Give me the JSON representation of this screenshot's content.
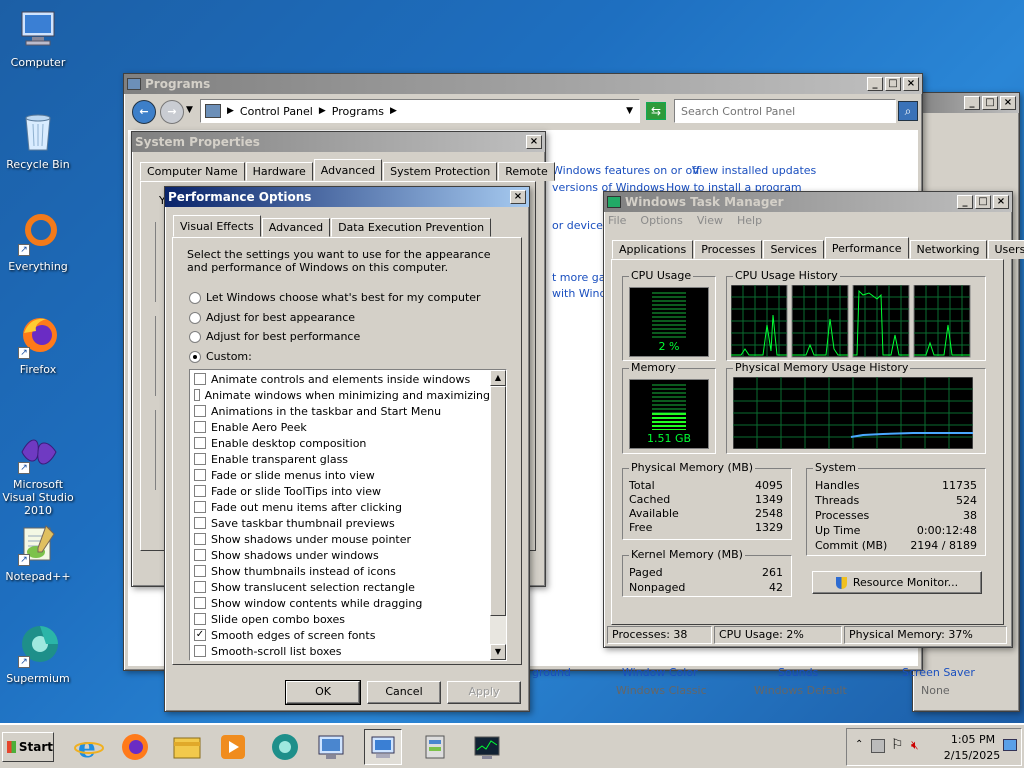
{
  "desktop": {
    "icons": [
      {
        "label": "Computer"
      },
      {
        "label": "Recycle Bin"
      },
      {
        "label": "Everything"
      },
      {
        "label": "Firefox"
      },
      {
        "label": "Microsoft Visual Studio 2010"
      },
      {
        "label": "Notepad++"
      },
      {
        "label": "Supermium"
      }
    ]
  },
  "programs_window": {
    "title": "Programs",
    "breadcrumb": [
      "Control Panel",
      "Programs"
    ],
    "search_placeholder": "Search Control Panel",
    "links": [
      "Windows features on or off",
      "View installed updates",
      "versions of Windows",
      "How to install a program",
      "or devices",
      "t more gad",
      "with Windo"
    ],
    "bottom_items": [
      {
        "title": "ground",
        "sub": ""
      },
      {
        "title": "Window Color",
        "sub": "Windows Classic"
      },
      {
        "title": "Sounds",
        "sub": "Windows Default"
      },
      {
        "title": "Screen Saver",
        "sub": "None"
      }
    ],
    "y_letter": "Y"
  },
  "system_properties": {
    "title": "System Properties",
    "tabs": [
      "Computer Name",
      "Hardware",
      "Advanced",
      "System Protection",
      "Remote"
    ],
    "selected_tab": "Advanced"
  },
  "performance_options": {
    "title": "Performance Options",
    "tabs": [
      "Visual Effects",
      "Advanced",
      "Data Execution Prevention"
    ],
    "description": "Select the settings you want to use for the appearance and performance of Windows on this computer.",
    "radios": [
      {
        "label": "Let Windows choose what's best for my computer",
        "checked": false
      },
      {
        "label": "Adjust for best appearance",
        "checked": false
      },
      {
        "label": "Adjust for best performance",
        "checked": false
      },
      {
        "label": "Custom:",
        "checked": true
      }
    ],
    "effects": [
      {
        "label": "Animate controls and elements inside windows",
        "checked": false
      },
      {
        "label": "Animate windows when minimizing and maximizing",
        "checked": false
      },
      {
        "label": "Animations in the taskbar and Start Menu",
        "checked": false
      },
      {
        "label": "Enable Aero Peek",
        "checked": false
      },
      {
        "label": "Enable desktop composition",
        "checked": false
      },
      {
        "label": "Enable transparent glass",
        "checked": false
      },
      {
        "label": "Fade or slide menus into view",
        "checked": false
      },
      {
        "label": "Fade or slide ToolTips into view",
        "checked": false
      },
      {
        "label": "Fade out menu items after clicking",
        "checked": false
      },
      {
        "label": "Save taskbar thumbnail previews",
        "checked": false
      },
      {
        "label": "Show shadows under mouse pointer",
        "checked": false
      },
      {
        "label": "Show shadows under windows",
        "checked": false
      },
      {
        "label": "Show thumbnails instead of icons",
        "checked": false
      },
      {
        "label": "Show translucent selection rectangle",
        "checked": false
      },
      {
        "label": "Show window contents while dragging",
        "checked": false
      },
      {
        "label": "Slide open combo boxes",
        "checked": false
      },
      {
        "label": "Smooth edges of screen fonts",
        "checked": true
      },
      {
        "label": "Smooth-scroll list boxes",
        "checked": false
      }
    ],
    "ok_label": "OK",
    "cancel_label": "Cancel",
    "apply_label": "Apply"
  },
  "task_manager": {
    "title": "Windows Task Manager",
    "menu": [
      "File",
      "Options",
      "View",
      "Help"
    ],
    "tabs": [
      "Applications",
      "Processes",
      "Services",
      "Performance",
      "Networking",
      "Users"
    ],
    "selected_tab": "Performance",
    "cpu_usage_label": "CPU Usage",
    "cpu_usage_value": "2 %",
    "cpu_history_label": "CPU Usage History",
    "memory_label": "Memory",
    "memory_value": "1.51 GB",
    "memory_fraction": 0.37,
    "physical_memory_history_label": "Physical Memory Usage History",
    "physical_memory": {
      "label": "Physical Memory (MB)",
      "rows": [
        {
          "name": "Total",
          "value": "4095"
        },
        {
          "name": "Cached",
          "value": "1349"
        },
        {
          "name": "Available",
          "value": "2548"
        },
        {
          "name": "Free",
          "value": "1329"
        }
      ]
    },
    "system": {
      "label": "System",
      "rows": [
        {
          "name": "Handles",
          "value": "11735"
        },
        {
          "name": "Threads",
          "value": "524"
        },
        {
          "name": "Processes",
          "value": "38"
        },
        {
          "name": "Up Time",
          "value": "0:00:12:48"
        },
        {
          "name": "Commit (MB)",
          "value": "2194 / 8189"
        }
      ]
    },
    "kernel_memory": {
      "label": "Kernel Memory (MB)",
      "rows": [
        {
          "name": "Paged",
          "value": "261"
        },
        {
          "name": "Nonpaged",
          "value": "42"
        }
      ]
    },
    "resource_monitor_label": "Resource Monitor...",
    "status": {
      "processes": "Processes: 38",
      "cpu": "CPU Usage: 2%",
      "memory": "Physical Memory: 37%"
    }
  },
  "taskbar": {
    "start_label": "Start",
    "time": "1:05 PM",
    "date": "2/15/2025"
  }
}
